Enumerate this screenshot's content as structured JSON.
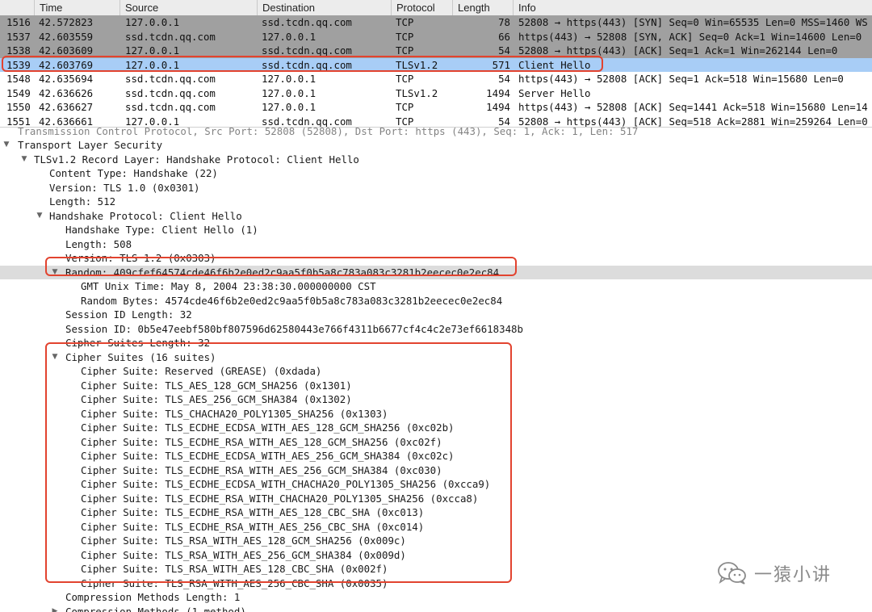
{
  "packet_list": {
    "columns": [
      "Time",
      "Source",
      "Destination",
      "Protocol",
      "Length",
      "Info"
    ],
    "rows": [
      {
        "no": "1516",
        "time": "42.572823",
        "source": "127.0.0.1",
        "destination": "ssd.tcdn.qq.com",
        "protocol": "TCP",
        "length": "78",
        "info": "52808 → https(443) [SYN] Seq=0 Win=65535 Len=0 MSS=1460 WS",
        "style": "gray"
      },
      {
        "no": "1537",
        "time": "42.603559",
        "source": "ssd.tcdn.qq.com",
        "destination": "127.0.0.1",
        "protocol": "TCP",
        "length": "66",
        "info": "https(443) → 52808 [SYN, ACK] Seq=0 Ack=1 Win=14600 Len=0",
        "style": "gray"
      },
      {
        "no": "1538",
        "time": "42.603609",
        "source": "127.0.0.1",
        "destination": "ssd.tcdn.qq.com",
        "protocol": "TCP",
        "length": "54",
        "info": "52808 → https(443) [ACK] Seq=1 Ack=1 Win=262144 Len=0",
        "style": "gray"
      },
      {
        "no": "1539",
        "time": "42.603769",
        "source": "127.0.0.1",
        "destination": "ssd.tcdn.qq.com",
        "protocol": "TLSv1.2",
        "length": "571",
        "info": "Client Hello",
        "style": "selected"
      },
      {
        "no": "1548",
        "time": "42.635694",
        "source": "ssd.tcdn.qq.com",
        "destination": "127.0.0.1",
        "protocol": "TCP",
        "length": "54",
        "info": "https(443) → 52808 [ACK] Seq=1 Ack=518 Win=15680 Len=0",
        "style": "white"
      },
      {
        "no": "1549",
        "time": "42.636626",
        "source": "ssd.tcdn.qq.com",
        "destination": "127.0.0.1",
        "protocol": "TLSv1.2",
        "length": "1494",
        "info": "Server Hello",
        "style": "white"
      },
      {
        "no": "1550",
        "time": "42.636627",
        "source": "ssd.tcdn.qq.com",
        "destination": "127.0.0.1",
        "protocol": "TCP",
        "length": "1494",
        "info": "https(443) → 52808 [ACK] Seq=1441 Ack=518 Win=15680 Len=14",
        "style": "white"
      },
      {
        "no": "1551",
        "time": "42.636661",
        "source": "127.0.0.1",
        "destination": "ssd.tcdn.qq.com",
        "protocol": "TCP",
        "length": "54",
        "info": "52808 → https(443) [ACK] Seq=518 Ack=2881 Win=259264 Len=0",
        "style": "white"
      }
    ]
  },
  "detail_tree": {
    "rows": [
      {
        "level": 0,
        "expander": "none",
        "text": "Transmission Control Protocol, Src Port: 52808 (52808), Dst Port: https (443), Seq: 1, Ack: 1, Len: 517",
        "cut": true
      },
      {
        "level": 0,
        "expander": "open",
        "text": "Transport Layer Security"
      },
      {
        "level": 1,
        "expander": "open",
        "text": "TLSv1.2 Record Layer: Handshake Protocol: Client Hello"
      },
      {
        "level": 2,
        "expander": "none",
        "text": "Content Type: Handshake (22)"
      },
      {
        "level": 2,
        "expander": "none",
        "text": "Version: TLS 1.0 (0x0301)"
      },
      {
        "level": 2,
        "expander": "none",
        "text": "Length: 512"
      },
      {
        "level": 2,
        "expander": "open",
        "text": "Handshake Protocol: Client Hello"
      },
      {
        "level": 3,
        "expander": "none",
        "text": "Handshake Type: Client Hello (1)"
      },
      {
        "level": 3,
        "expander": "none",
        "text": "Length: 508"
      },
      {
        "level": 3,
        "expander": "none",
        "text": "Version: TLS 1.2 (0x0303)"
      },
      {
        "level": 3,
        "expander": "open",
        "text": "Random: 409cfef64574cde46f6b2e0ed2c9aa5f0b5a8c783a083c3281b2eecec0e2ec84",
        "highlight": true
      },
      {
        "level": 4,
        "expander": "none",
        "text": "GMT Unix Time: May  8, 2004 23:38:30.000000000 CST"
      },
      {
        "level": 4,
        "expander": "none",
        "text": "Random Bytes: 4574cde46f6b2e0ed2c9aa5f0b5a8c783a083c3281b2eecec0e2ec84"
      },
      {
        "level": 3,
        "expander": "none",
        "text": "Session ID Length: 32"
      },
      {
        "level": 3,
        "expander": "none",
        "text": "Session ID: 0b5e47eebf580bf807596d62580443e766f4311b6677cf4c4c2e73ef6618348b"
      },
      {
        "level": 3,
        "expander": "none",
        "text": "Cipher Suites Length: 32"
      },
      {
        "level": 3,
        "expander": "open",
        "text": "Cipher Suites (16 suites)"
      },
      {
        "level": 4,
        "expander": "none",
        "text": "Cipher Suite: Reserved (GREASE) (0xdada)"
      },
      {
        "level": 4,
        "expander": "none",
        "text": "Cipher Suite: TLS_AES_128_GCM_SHA256 (0x1301)"
      },
      {
        "level": 4,
        "expander": "none",
        "text": "Cipher Suite: TLS_AES_256_GCM_SHA384 (0x1302)"
      },
      {
        "level": 4,
        "expander": "none",
        "text": "Cipher Suite: TLS_CHACHA20_POLY1305_SHA256 (0x1303)"
      },
      {
        "level": 4,
        "expander": "none",
        "text": "Cipher Suite: TLS_ECDHE_ECDSA_WITH_AES_128_GCM_SHA256 (0xc02b)"
      },
      {
        "level": 4,
        "expander": "none",
        "text": "Cipher Suite: TLS_ECDHE_RSA_WITH_AES_128_GCM_SHA256 (0xc02f)"
      },
      {
        "level": 4,
        "expander": "none",
        "text": "Cipher Suite: TLS_ECDHE_ECDSA_WITH_AES_256_GCM_SHA384 (0xc02c)"
      },
      {
        "level": 4,
        "expander": "none",
        "text": "Cipher Suite: TLS_ECDHE_RSA_WITH_AES_256_GCM_SHA384 (0xc030)"
      },
      {
        "level": 4,
        "expander": "none",
        "text": "Cipher Suite: TLS_ECDHE_ECDSA_WITH_CHACHA20_POLY1305_SHA256 (0xcca9)"
      },
      {
        "level": 4,
        "expander": "none",
        "text": "Cipher Suite: TLS_ECDHE_RSA_WITH_CHACHA20_POLY1305_SHA256 (0xcca8)"
      },
      {
        "level": 4,
        "expander": "none",
        "text": "Cipher Suite: TLS_ECDHE_RSA_WITH_AES_128_CBC_SHA (0xc013)"
      },
      {
        "level": 4,
        "expander": "none",
        "text": "Cipher Suite: TLS_ECDHE_RSA_WITH_AES_256_CBC_SHA (0xc014)"
      },
      {
        "level": 4,
        "expander": "none",
        "text": "Cipher Suite: TLS_RSA_WITH_AES_128_GCM_SHA256 (0x009c)"
      },
      {
        "level": 4,
        "expander": "none",
        "text": "Cipher Suite: TLS_RSA_WITH_AES_256_GCM_SHA384 (0x009d)"
      },
      {
        "level": 4,
        "expander": "none",
        "text": "Cipher Suite: TLS_RSA_WITH_AES_128_CBC_SHA (0x002f)"
      },
      {
        "level": 4,
        "expander": "none",
        "text": "Cipher Suite: TLS_RSA_WITH_AES_256_CBC_SHA (0x0035)"
      },
      {
        "level": 3,
        "expander": "none",
        "text": "Compression Methods Length: 1"
      },
      {
        "level": 3,
        "expander": "closed",
        "text": "Compression Methods (1 method)"
      }
    ]
  },
  "watermark": {
    "icon": "wechat-icon",
    "text": "一猿小讲"
  },
  "colors": {
    "annotation": "#e2432f",
    "selected_row": "#a8cdf6",
    "gray_row": "#a0a0a0",
    "highlight_row": "#dcdcdc"
  }
}
